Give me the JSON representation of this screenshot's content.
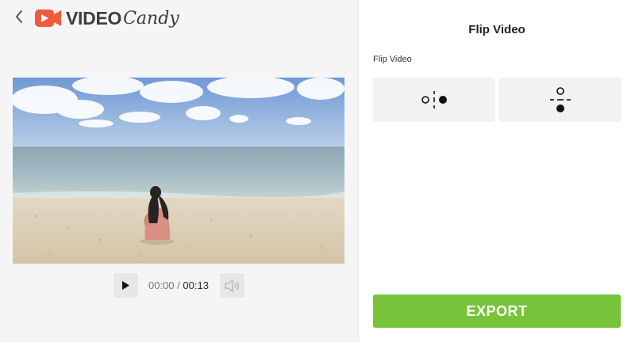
{
  "brand": {
    "word1": "VIDEO",
    "word2": "Candy",
    "color": "#f15a3a"
  },
  "header": {
    "back_icon": "chevron-left-icon"
  },
  "video": {
    "scene": "beach"
  },
  "player": {
    "play_icon": "play-icon",
    "current_time": "00:00",
    "separator": " / ",
    "total_time": "00:13",
    "volume_icon": "volume-muted-icon"
  },
  "panel": {
    "title": "Flip Video",
    "section_label": "Flip Video",
    "options": [
      {
        "icon": "flip-horizontal-icon"
      },
      {
        "icon": "flip-vertical-icon"
      }
    ],
    "export_label": "EXPORT",
    "export_color": "#77c33a"
  }
}
